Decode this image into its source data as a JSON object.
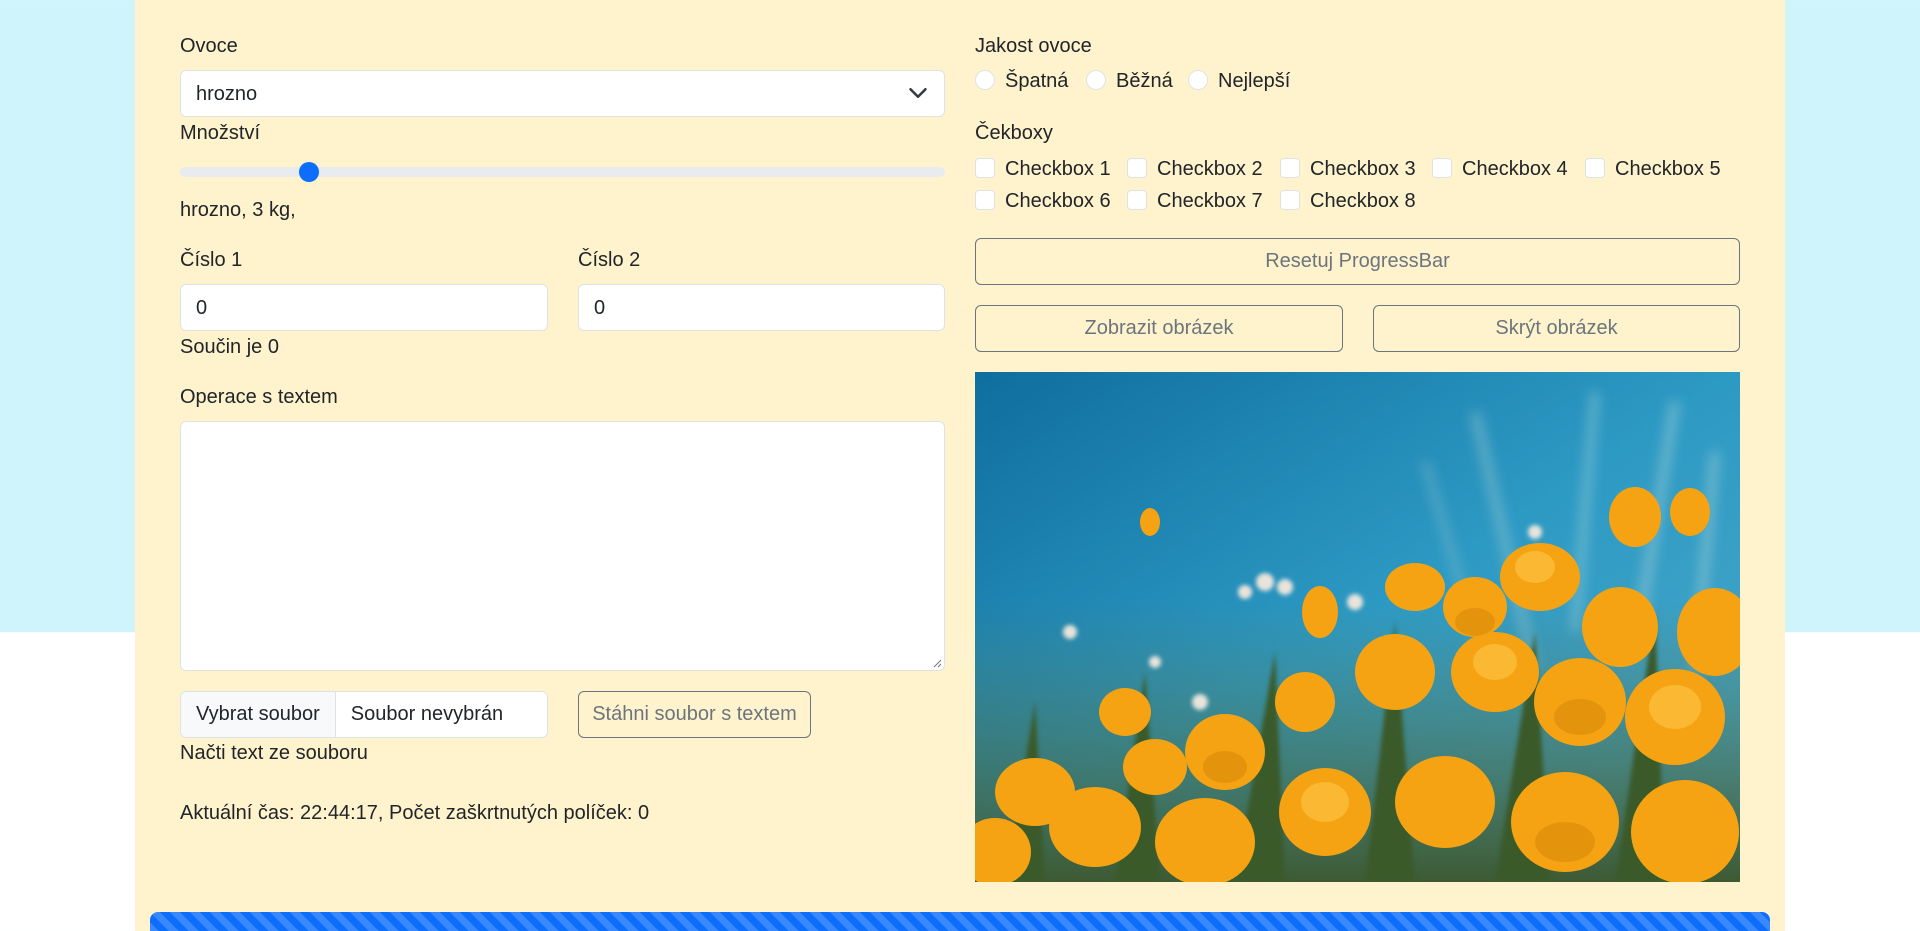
{
  "left": {
    "fruit_label": "Ovoce",
    "fruit_selected": "hrozno",
    "amount_label": "Množství",
    "amount_slider_fraction": 0.16,
    "summary": "hrozno, 3 kg,",
    "num1_label": "Číslo 1",
    "num1_value": "0",
    "num2_label": "Číslo 2",
    "num2_value": "0",
    "product_text": "Součin je 0",
    "text_ops_label": "Operace s textem",
    "textarea_value": "",
    "file_button": "Vybrat soubor",
    "file_status": "Soubor nevybrán",
    "download_button": "Stáhni soubor s textem",
    "load_text_label": "Načti text ze souboru",
    "status_line": "Aktuální čas: 22:44:17, Počet zaškrtnutých políček: 0"
  },
  "right": {
    "quality_label": "Jakost ovoce",
    "quality_options": [
      "Špatná",
      "Běžná",
      "Nejlepší"
    ],
    "checkboxes_label": "Čekboxy",
    "checkboxes": [
      "Checkbox 1",
      "Checkbox 2",
      "Checkbox 3",
      "Checkbox 4",
      "Checkbox 5",
      "Checkbox 6",
      "Checkbox 7",
      "Checkbox 8"
    ],
    "reset_button": "Resetuj ProgressBar",
    "show_image_button": "Zobrazit obrázek",
    "hide_image_button": "Skrýt obrázek",
    "image_icon": "flowers-photo"
  },
  "progress": {
    "value_percent": 100,
    "color": "#0d6efd"
  },
  "colors": {
    "background_top": "#cff4fc",
    "container": "#fff3cd",
    "accent": "#0d6efd"
  }
}
